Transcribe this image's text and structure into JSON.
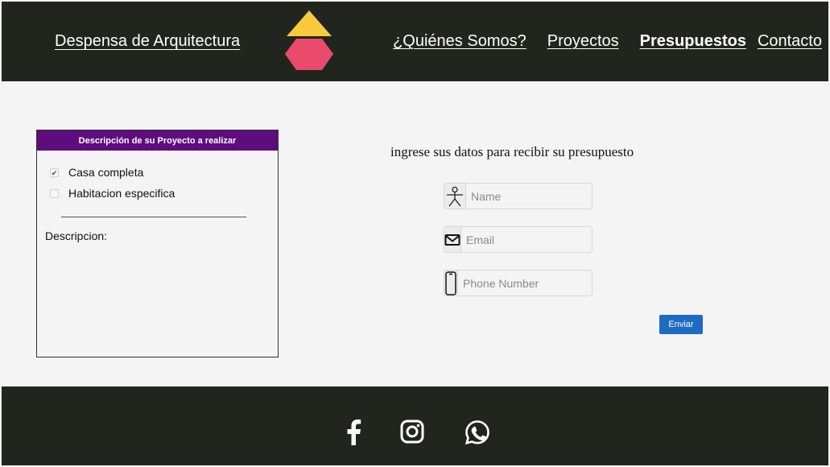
{
  "header": {
    "brand": "Despensa de Arquitectura",
    "logo_icon": "stacked-triangle-hexagon-logo",
    "nav": [
      {
        "label": "¿Quiénes Somos?",
        "active": false
      },
      {
        "label": "Proyectos",
        "active": false
      },
      {
        "label": "Presupuestos",
        "active": true
      },
      {
        "label": "Contacto",
        "active": false
      }
    ]
  },
  "project_panel": {
    "title": "Descripción de su Proyecto a realizar",
    "options": [
      {
        "label": "Casa completa",
        "checked": true
      },
      {
        "label": "Habitacion especifica",
        "checked": false
      }
    ],
    "description_label": "Descripcion:"
  },
  "form": {
    "title": "ingrese sus datos para recibir su presupuesto",
    "fields": [
      {
        "icon": "person-icon",
        "placeholder": "Name",
        "value": ""
      },
      {
        "icon": "envelope-icon",
        "placeholder": "Email",
        "value": ""
      },
      {
        "icon": "phone-icon",
        "placeholder": "Phone Number",
        "value": ""
      }
    ],
    "submit_label": "Enviar"
  },
  "footer": {
    "social": [
      "facebook-icon",
      "instagram-icon",
      "whatsapp-icon"
    ]
  },
  "colors": {
    "header_bg": "#20261d",
    "panel_header": "#5e0c7e",
    "button": "#1e6ac4",
    "logo_yellow": "#f9c93e",
    "logo_pink": "#ea4a6b"
  }
}
